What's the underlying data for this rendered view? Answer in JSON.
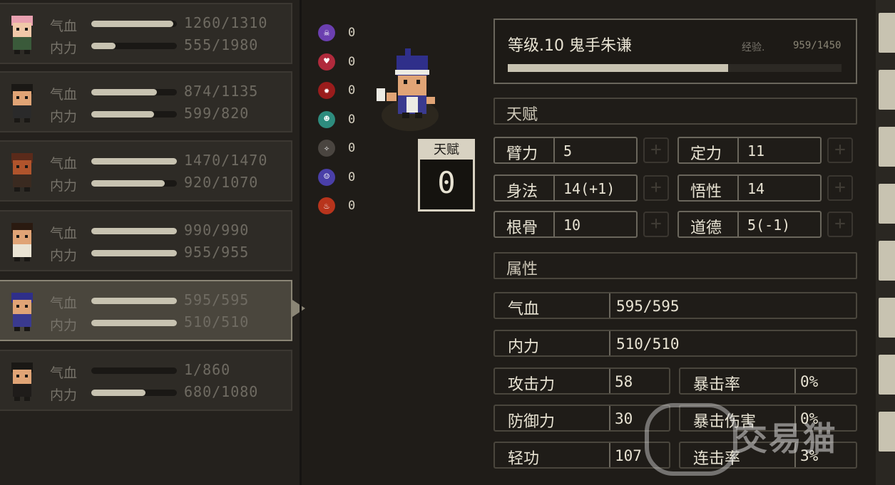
{
  "party": [
    {
      "hp_label": "气血",
      "mp_label": "内力",
      "hp": "1260/1310",
      "mp": "555/1980",
      "hp_frac": 0.96,
      "mp_frac": 0.28
    },
    {
      "hp_label": "气血",
      "mp_label": "内力",
      "hp": "874/1135",
      "mp": "599/820",
      "hp_frac": 0.77,
      "mp_frac": 0.73
    },
    {
      "hp_label": "气血",
      "mp_label": "内力",
      "hp": "1470/1470",
      "mp": "920/1070",
      "hp_frac": 1.0,
      "mp_frac": 0.86
    },
    {
      "hp_label": "气血",
      "mp_label": "内力",
      "hp": "990/990",
      "mp": "955/955",
      "hp_frac": 1.0,
      "mp_frac": 1.0
    },
    {
      "hp_label": "气血",
      "mp_label": "内力",
      "hp": "595/595",
      "mp": "510/510",
      "hp_frac": 1.0,
      "mp_frac": 1.0
    },
    {
      "hp_label": "气血",
      "mp_label": "内力",
      "hp": "1/860",
      "mp": "680/1080",
      "hp_frac": 0.0,
      "mp_frac": 0.63
    }
  ],
  "status_effects": [
    {
      "icon": "skull-icon",
      "color": "#6b3fb0",
      "count": "0"
    },
    {
      "icon": "broken-heart-icon",
      "color": "#b02a3c",
      "count": "0"
    },
    {
      "icon": "blood-drop-icon",
      "color": "#9a1c1c",
      "count": "0"
    },
    {
      "icon": "toxic-icon",
      "color": "#2e8c7e",
      "count": "0"
    },
    {
      "icon": "dizzy-icon",
      "color": "#4a4540",
      "count": "0"
    },
    {
      "icon": "frozen-face-icon",
      "color": "#4a3fa8",
      "count": "0"
    },
    {
      "icon": "flame-icon",
      "color": "#b8341c",
      "count": "0"
    }
  ],
  "talent": {
    "label": "天赋",
    "value": "0"
  },
  "header": {
    "title": "等级.10 鬼手朱谦",
    "exp_label": "经验.",
    "exp_value": "959/1450",
    "exp_frac": 0.66
  },
  "sections": {
    "talent_title": "天赋",
    "attr_title": "属性"
  },
  "talents": [
    {
      "name": "臂力",
      "value": "5"
    },
    {
      "name": "定力",
      "value": "11"
    },
    {
      "name": "身法",
      "value": "14(+1)"
    },
    {
      "name": "悟性",
      "value": "14"
    },
    {
      "name": "根骨",
      "value": "10"
    },
    {
      "name": "道德",
      "value": "5(-1)"
    }
  ],
  "attributes": {
    "hp": {
      "name": "气血",
      "value": "595/595"
    },
    "mp": {
      "name": "内力",
      "value": "510/510"
    },
    "atk": {
      "name": "攻击力",
      "value": "58"
    },
    "crit_rate": {
      "name": "暴击率",
      "value": "0%"
    },
    "def": {
      "name": "防御力",
      "value": "30"
    },
    "crit_dmg": {
      "name": "暴击伤害",
      "value": "0%"
    },
    "speed": {
      "name": "轻功",
      "value": "107"
    },
    "combo": {
      "name": "连击率",
      "value": "3%"
    }
  },
  "watermark": "交易猫"
}
